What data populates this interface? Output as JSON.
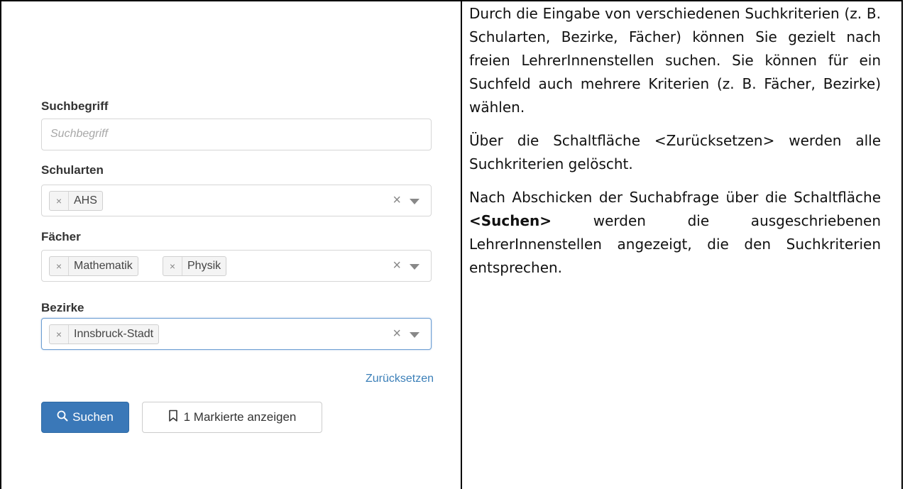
{
  "form": {
    "search_term": {
      "label": "Suchbegriff",
      "placeholder": "Suchbegriff",
      "value": ""
    },
    "school_types": {
      "label": "Schularten",
      "tags": [
        "AHS"
      ]
    },
    "subjects": {
      "label": "Fächer",
      "tags": [
        "Mathematik",
        "Physik"
      ]
    },
    "districts": {
      "label": "Bezirke",
      "tags": [
        "Innsbruck-Stadt"
      ]
    },
    "tag_remove_glyph": "×",
    "clear_glyph": "×",
    "reset_label": "Zurücksetzen",
    "search_button_label": "Suchen",
    "marked_button_label": "1 Markierte anzeigen"
  },
  "description": {
    "paragraph1": "Durch die Eingabe von verschiedenen Suchkriterien (z. B. Schularten, Bezirke, Fächer) können Sie gezielt nach freien LehrerInnenstellen suchen. Sie können für ein Suchfeld auch mehrere Kriterien (z. B. Fächer, Bezirke) wählen.",
    "paragraph2": "Über die Schaltfläche <Zurücksetzen> werden alle Suchkriterien gelöscht.",
    "paragraph3_before": "Nach Abschicken der Suchabfrage über die Schaltfläche ",
    "paragraph3_bold": "<Suchen>",
    "paragraph3_after": " werden die ausgeschriebenen LehrerInnenstellen angezeigt, die den Suchkriterien entsprechen."
  },
  "colors": {
    "primary_button": "#3a78b8",
    "link": "#3b7fb8",
    "focus_border": "#6d9fd3"
  },
  "icons": {
    "search_button": "search-icon",
    "marked_button": "bookmark-icon",
    "clear": "clear-icon",
    "dropdown": "caret-down-icon"
  }
}
